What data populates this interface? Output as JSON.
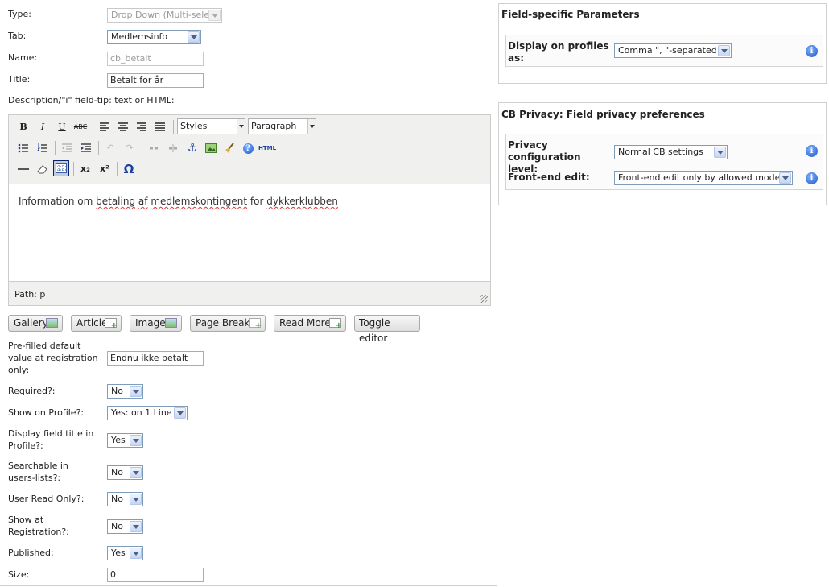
{
  "form": {
    "type": {
      "label": "Type:",
      "value": "Drop Down (Multi-select)"
    },
    "tab": {
      "label": "Tab:",
      "value": "Medlemsinfo"
    },
    "name": {
      "label": "Name:",
      "value": "cb_betalt"
    },
    "title": {
      "label": "Title:",
      "value": "Betalt for år"
    },
    "description_label": "Description/\"i\" field-tip: text or HTML:",
    "prefilled": {
      "label": "Pre-filled default value at registration only:",
      "value": "Endnu ikke betalt"
    },
    "required": {
      "label": "Required?:",
      "value": "No"
    },
    "show_on_profile": {
      "label": "Show on Profile?:",
      "value": "Yes: on 1 Line"
    },
    "display_title": {
      "label": "Display field title in Profile?:",
      "value": "Yes"
    },
    "searchable": {
      "label": "Searchable in users-lists?:",
      "value": "No"
    },
    "user_read_only": {
      "label": "User Read Only?:",
      "value": "No"
    },
    "show_at_registration": {
      "label": "Show at Registration?:",
      "value": "No"
    },
    "published": {
      "label": "Published:",
      "value": "Yes"
    },
    "size": {
      "label": "Size:",
      "value": "0"
    }
  },
  "editor": {
    "bold": "B",
    "italic": "I",
    "underline": "U",
    "strike": "ABC",
    "styles": "Styles",
    "format": "Paragraph",
    "html_btn": "HTML",
    "sub": "x₂",
    "sup": "x²",
    "omega": "Ω",
    "content": {
      "p1": "Information om ",
      "w1": "betaling",
      "p2": " ",
      "w2": "af",
      "p3": " ",
      "w3": "medlemskontingent",
      "p4": " for ",
      "w4": "dykkerklubben"
    },
    "status": "Path: p"
  },
  "editor_buttons": [
    "Gallery",
    "Article",
    "Image",
    "Page Break",
    "Read More",
    "Toggle editor"
  ],
  "field_params": {
    "title": "Field-specific Parameters",
    "display_label": "Display on profiles as:",
    "display_value": "Comma \", \"-separated line"
  },
  "privacy": {
    "title": "CB Privacy: Field privacy preferences",
    "config_label": "Privacy configuration level:",
    "config_value": "Normal CB settings",
    "frontend_label": "Front-end edit:",
    "frontend_value": "Front-end edit only by allowed moderators"
  },
  "colors": {
    "info_icon": "#1d56c8",
    "toolbar_bg": "#f0f0ee",
    "select_border": "#7f9db9"
  }
}
